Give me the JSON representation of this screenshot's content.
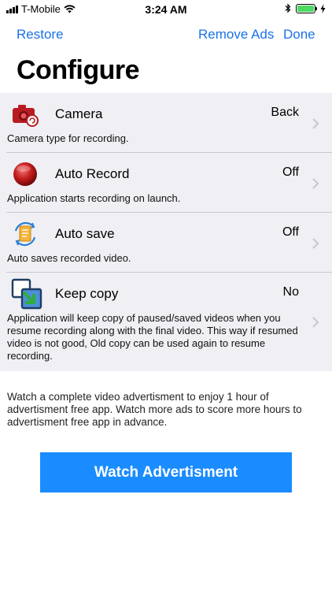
{
  "status": {
    "carrier": "T-Mobile",
    "time": "3:24 AM"
  },
  "nav": {
    "restore_label": "Restore",
    "remove_ads_label": "Remove Ads",
    "done_label": "Done"
  },
  "page": {
    "title": "Configure"
  },
  "settings": [
    {
      "title": "Camera",
      "value": "Back",
      "description": "Camera type for recording.",
      "icon": "camera-icon"
    },
    {
      "title": "Auto Record",
      "value": "Off",
      "description": "Application starts recording on launch.",
      "icon": "record-icon"
    },
    {
      "title": "Auto save",
      "value": "Off",
      "description": "Auto saves recorded video.",
      "icon": "auto-save-icon"
    },
    {
      "title": "Keep copy",
      "value": "No",
      "description": "Application will keep copy of paused/saved videos when you resume recording along with the final video. This way if resumed video is not good, Old copy can be used again to resume recording.",
      "icon": "keep-copy-icon"
    }
  ],
  "footer": {
    "text": "Watch a complete video advertisment to enjoy 1 hour of advertisment free app. Watch more ads to score more hours to advertisment free app in advance.",
    "button_label": "Watch Advertisment"
  },
  "colors": {
    "accent": "#1a73e8",
    "button": "#1a8cff",
    "list_background": "#efeff4",
    "battery": "#4cd964"
  }
}
